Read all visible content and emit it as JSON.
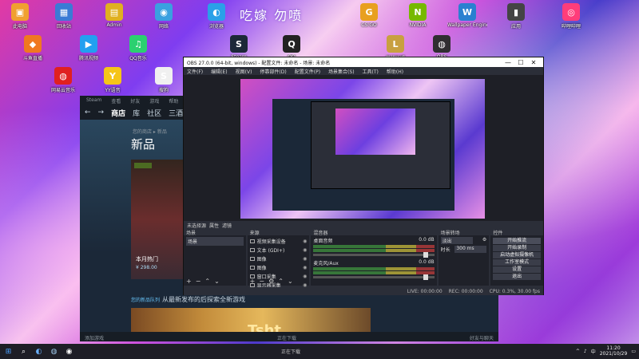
{
  "desktop": {
    "title": "吃嫁 勿喷",
    "icons": [
      {
        "label": "此电脑",
        "color": "#f0a030",
        "glyph": "▣"
      },
      {
        "label": "回收站",
        "color": "#3a7bd5",
        "glyph": "▦"
      },
      {
        "label": "Admin",
        "color": "#e0b020",
        "glyph": "▤"
      },
      {
        "label": "网络",
        "color": "#3aa0e0",
        "glyph": "◉"
      },
      {
        "label": "控制面板",
        "color": "#3a7bd5",
        "glyph": "◈"
      },
      {
        "label": "浏览器",
        "color": "#2aa0e8",
        "glyph": "◐"
      },
      {
        "label": "CS:GO",
        "color": "#e8a020",
        "glyph": "G"
      },
      {
        "label": "NVIDIA",
        "color": "#76b900",
        "glyph": "N"
      },
      {
        "label": "Wallpaper Engine",
        "color": "#2a80d0",
        "glyph": "W"
      },
      {
        "label": "应用",
        "color": "#444",
        "glyph": "▮"
      },
      {
        "label": "哔哩哔哩",
        "color": "#ff3d7a",
        "glyph": "◎"
      },
      {
        "label": "斗鱼直播",
        "color": "#f07820",
        "glyph": "◆"
      },
      {
        "label": "腾讯视频",
        "color": "#22a0f0",
        "glyph": "▶"
      },
      {
        "label": "QQ音乐",
        "color": "#2bd070",
        "glyph": "♫"
      },
      {
        "label": "Steam",
        "color": "#1b2838",
        "glyph": "S"
      },
      {
        "label": "QQ",
        "color": "#222",
        "glyph": "Q"
      },
      {
        "label": "英雄联盟",
        "color": "#c8a040",
        "glyph": "L"
      },
      {
        "label": "OBS",
        "color": "#302e31",
        "glyph": "◍"
      },
      {
        "label": "网易云音乐",
        "color": "#e02020",
        "glyph": "◍"
      },
      {
        "label": "YY语音",
        "color": "#f5c518",
        "glyph": "Y"
      },
      {
        "label": "搜狗",
        "color": "#f0f0f0",
        "glyph": "S"
      }
    ]
  },
  "steam": {
    "top_menu": [
      "Steam",
      "查看",
      "好友",
      "游戏",
      "帮助"
    ],
    "nav": {
      "back": "←",
      "forward": "→",
      "store": "商店",
      "library": "库",
      "community": "社区",
      "user": "三酒"
    },
    "breadcrumb": "您的商店 ▸ 新品",
    "heading": "新品",
    "card": {
      "tag": "已获优惠",
      "title": "本月热门",
      "price": "¥ 298.00"
    },
    "news": {
      "prefix": "您的新品队列",
      "text": "从最新发布的后探索全新游戏"
    },
    "banner_text": "Tsht",
    "bottom": {
      "left": "添加游戏",
      "center": "正在下载",
      "right": "好友与聊天"
    }
  },
  "obs": {
    "title": "OBS 27.0.0 (64-bit, windows) - 配置文件: 未命名 - 场景: 未命名",
    "window_buttons": [
      "—",
      "☐",
      "✕"
    ],
    "menu": [
      "文件(F)",
      "编辑(E)",
      "视图(V)",
      "停靠部件(D)",
      "配置文件(P)",
      "场景集合(S)",
      "工具(T)",
      "帮助(H)"
    ],
    "status_strip": {
      "label": "未选择源",
      "props": "属性",
      "filters": "滤镜"
    },
    "docks": {
      "scenes": {
        "title": "场景",
        "items": [
          "场景"
        ]
      },
      "sources": {
        "title": "来源",
        "items": [
          "视频采集设备",
          "文本 (GDI+)",
          "图像",
          "图像",
          "窗口采集",
          "显示器采集"
        ]
      },
      "mixer": {
        "title": "混音器",
        "rows": [
          {
            "name": "桌面音频",
            "db": "0.0 dB"
          },
          {
            "name": "麦克风/Aux",
            "db": "0.0 dB"
          }
        ]
      },
      "transitions": {
        "title": "场景转场",
        "type_label": "淡出",
        "duration_label": "时长",
        "duration_value": "300 ms"
      },
      "controls": {
        "title": "控件",
        "buttons": [
          "开始推流",
          "开始录制",
          "启动虚拟摄像机",
          "工作室模式",
          "设置",
          "退出"
        ]
      }
    },
    "footer": {
      "live": "LIVE: 00:00:00",
      "rec": "REC: 00:00:00",
      "cpu": "CPU: 0.3%, 30.00 fps"
    }
  },
  "taskbar": {
    "center_text": "正在下载",
    "time": "11:20",
    "date": "2021/10/29",
    "tray": [
      "^",
      "♪",
      "中",
      "▭"
    ]
  }
}
